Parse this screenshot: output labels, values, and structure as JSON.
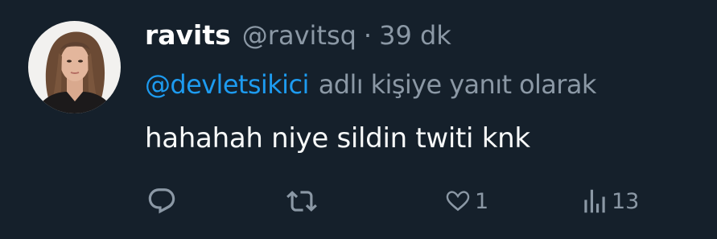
{
  "tweet": {
    "author": {
      "display_name": "ravits",
      "handle": "@ravitsq"
    },
    "separator": "·",
    "time": "39 dk",
    "reply_to": {
      "mention": "@devletsikici",
      "suffix": "adlı kişiye yanıt olarak"
    },
    "text": "hahahah niye sildin twiti knk",
    "actions": {
      "reply": {
        "icon": "reply-icon",
        "count": ""
      },
      "retweet": {
        "icon": "retweet-icon",
        "count": ""
      },
      "like": {
        "icon": "heart-icon",
        "count": "1"
      },
      "views": {
        "icon": "views-icon",
        "count": "13"
      }
    }
  },
  "colors": {
    "background": "#15202b",
    "primary_text": "#ffffff",
    "secondary_text": "#8b98a5",
    "accent": "#1d9bf0"
  }
}
